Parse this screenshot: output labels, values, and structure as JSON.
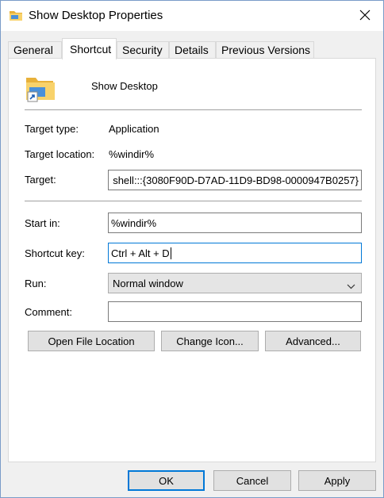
{
  "window": {
    "title": "Show Desktop Properties",
    "close_icon": "close-icon",
    "title_icon": "folder-icon"
  },
  "tabs": [
    {
      "label": "General",
      "active": false
    },
    {
      "label": "Shortcut",
      "active": true
    },
    {
      "label": "Security",
      "active": false
    },
    {
      "label": "Details",
      "active": false
    },
    {
      "label": "Previous Versions",
      "active": false
    }
  ],
  "shortcut": {
    "name": "Show Desktop",
    "icon": "folder-shortcut-icon",
    "target_type_label": "Target type:",
    "target_type_value": "Application",
    "target_location_label": "Target location:",
    "target_location_value": "%windir%",
    "target_label": "Target:",
    "target_value": "shell:::{3080F90D-D7AD-11D9-BD98-0000947B0257}",
    "start_in_label": "Start in:",
    "start_in_value": "%windir%",
    "shortcut_key_label": "Shortcut key:",
    "shortcut_key_value": "Ctrl + Alt + D",
    "run_label": "Run:",
    "run_value": "Normal window",
    "comment_label": "Comment:",
    "comment_value": "",
    "open_file_location_label": "Open File Location",
    "change_icon_label": "Change Icon...",
    "advanced_label": "Advanced..."
  },
  "footer": {
    "ok_label": "OK",
    "cancel_label": "Cancel",
    "apply_label": "Apply"
  },
  "colors": {
    "accent": "#0078d7",
    "folder_yellow": "#f8c44e"
  }
}
